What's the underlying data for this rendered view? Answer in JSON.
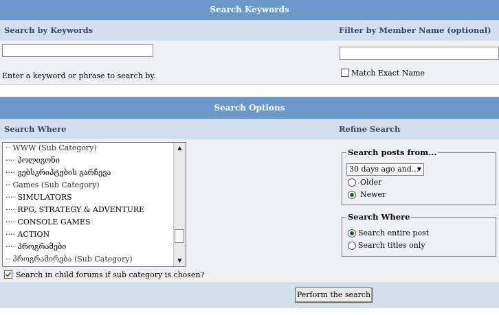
{
  "keywords_section": {
    "header": "Search Keywords",
    "left_label": "Search by Keywords",
    "right_label": "Filter by Member Name (optional)",
    "keyword_value": "",
    "keyword_help": "Enter a keyword or phrase to search by.",
    "member_value": "",
    "exact_match_label": "Match Exact Name",
    "exact_match_checked": false
  },
  "options_section": {
    "header": "Search Options",
    "left_label": "Search Where",
    "right_label": "Refine Search"
  },
  "forum_list": {
    "items": [
      {
        "label": "·· WWW (Sub Category)",
        "type": "category"
      },
      {
        "label": "···· პოლიგონი",
        "type": "forum"
      },
      {
        "label": "···· ვებსკრიპტების გარჩევა",
        "type": "forum"
      },
      {
        "label": "·· Games (Sub Category)",
        "type": "category"
      },
      {
        "label": "···· SIMULATORS",
        "type": "forum"
      },
      {
        "label": "···· RPG, STRATEGY & ADVENTURE",
        "type": "forum"
      },
      {
        "label": "···· CONSOLE GAMES",
        "type": "forum"
      },
      {
        "label": "···· ACTION",
        "type": "forum"
      },
      {
        "label": "···· პროგრამები",
        "type": "forum"
      },
      {
        "label": "·· პროგრამირება (Sub Category)",
        "type": "category"
      }
    ],
    "child_forums_label": "Search in child forums if sub category is chosen?",
    "child_forums_checked": true
  },
  "posts_from": {
    "legend": "Search posts from...",
    "selected": "30 days ago and...",
    "older_label": "Older",
    "newer_label": "Newer",
    "selected_direction": "Newer"
  },
  "search_where": {
    "legend": "Search Where",
    "entire_post_label": "Search entire post",
    "titles_only_label": "Search titles only",
    "selected": "Search entire post"
  },
  "submit_label": "Perform the search"
}
